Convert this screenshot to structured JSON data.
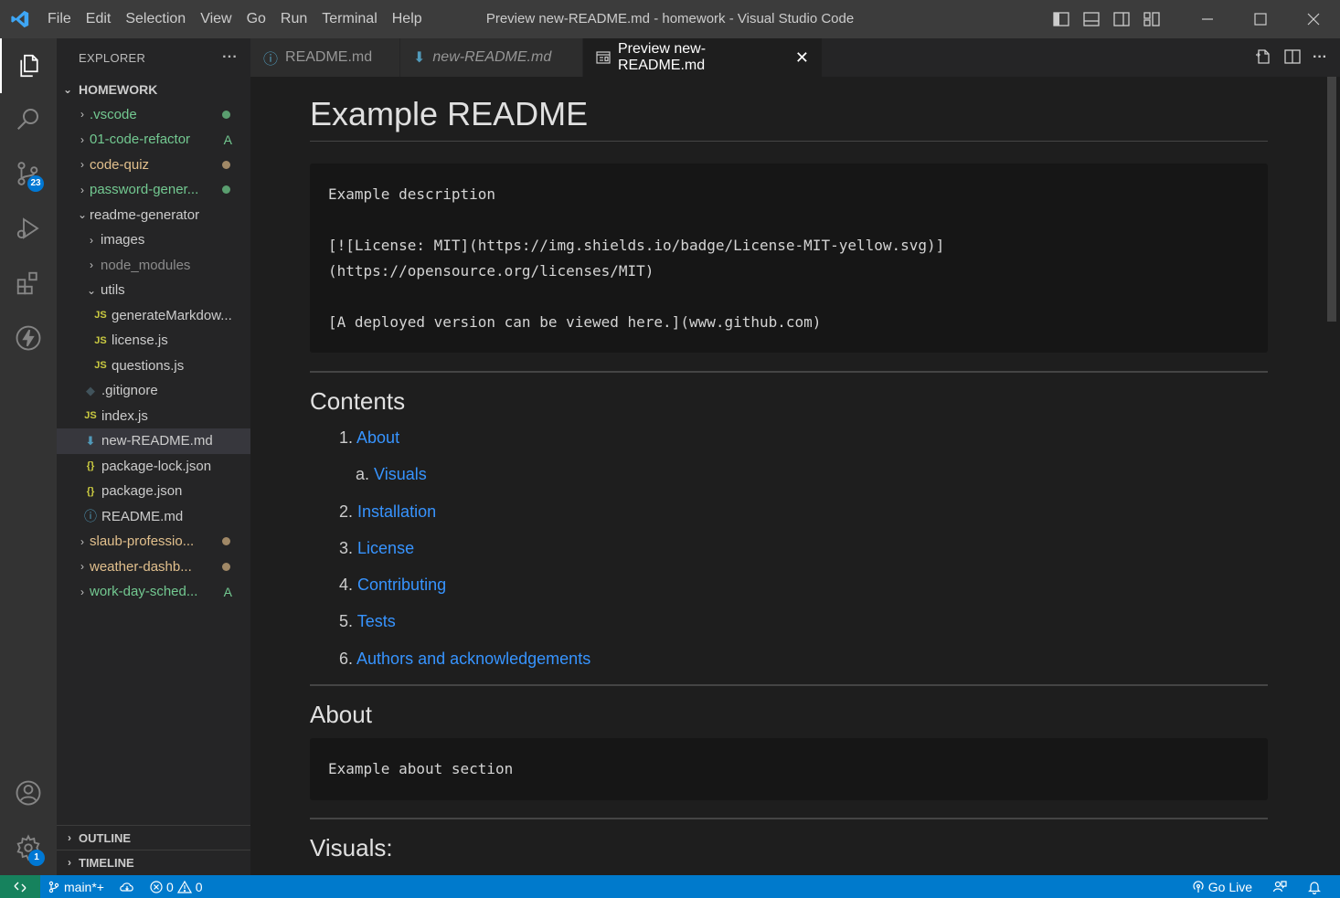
{
  "titlebar": {
    "menu": [
      "File",
      "Edit",
      "Selection",
      "View",
      "Go",
      "Run",
      "Terminal",
      "Help"
    ],
    "window_title": "Preview new-README.md - homework - Visual Studio Code"
  },
  "activity": {
    "source_control_badge": "23",
    "settings_badge": "1"
  },
  "sidebar": {
    "title": "EXPLORER",
    "more": "···",
    "root": "HOMEWORK",
    "items": [
      {
        "label": ".vscode",
        "color": "#73c991",
        "git": "dot"
      },
      {
        "label": "01-code-refactor",
        "color": "#73c991",
        "git": "A"
      },
      {
        "label": "code-quiz",
        "color": "#e2c08d",
        "git": "dot"
      },
      {
        "label": "password-gener...",
        "color": "#73c991",
        "git": "dot"
      },
      {
        "label": "readme-generator",
        "color": "#cccccc",
        "git": ""
      },
      {
        "label": "images",
        "color": "#cccccc",
        "git": ""
      },
      {
        "label": "node_modules",
        "color": "#8c8c8c",
        "git": ""
      },
      {
        "label": "utils",
        "color": "#cccccc",
        "git": ""
      },
      {
        "label": "generateMarkdow...",
        "color": "#cccccc",
        "git": ""
      },
      {
        "label": "license.js",
        "color": "#cccccc",
        "git": ""
      },
      {
        "label": "questions.js",
        "color": "#cccccc",
        "git": ""
      },
      {
        "label": ".gitignore",
        "color": "#cccccc",
        "git": ""
      },
      {
        "label": "index.js",
        "color": "#cccccc",
        "git": ""
      },
      {
        "label": "new-README.md",
        "color": "#cccccc",
        "git": ""
      },
      {
        "label": "package-lock.json",
        "color": "#cccccc",
        "git": ""
      },
      {
        "label": "package.json",
        "color": "#cccccc",
        "git": ""
      },
      {
        "label": "README.md",
        "color": "#cccccc",
        "git": ""
      },
      {
        "label": "slaub-professio...",
        "color": "#e2c08d",
        "git": "dot"
      },
      {
        "label": "weather-dashb...",
        "color": "#e2c08d",
        "git": "dot"
      },
      {
        "label": "work-day-sched...",
        "color": "#73c991",
        "git": "A"
      }
    ],
    "outline": "OUTLINE",
    "timeline": "TIMELINE"
  },
  "tabs": [
    {
      "label": "README.md"
    },
    {
      "label": "new-README.md"
    },
    {
      "label": "Preview new-README.md",
      "close": "✕"
    }
  ],
  "preview": {
    "title": "Example README",
    "code_lines": [
      "Example description",
      "",
      "[![License: MIT](https://img.shields.io/badge/License-MIT-yellow.svg)]",
      "(https://opensource.org/licenses/MIT)",
      "",
      "[A deployed version can be viewed here.](www.github.com)"
    ],
    "contents_heading": "Contents",
    "toc": [
      {
        "num": "1.",
        "label": "About"
      },
      {
        "num": "a.",
        "label": "Visuals"
      },
      {
        "num": "2.",
        "label": "Installation"
      },
      {
        "num": "3.",
        "label": "License"
      },
      {
        "num": "4.",
        "label": "Contributing"
      },
      {
        "num": "5.",
        "label": "Tests"
      },
      {
        "num": "6.",
        "label": "Authors and acknowledgements"
      }
    ],
    "about_heading": "About",
    "about_code": "Example about section",
    "visuals_heading": "Visuals:"
  },
  "status": {
    "branch": "main*+",
    "errors": "0",
    "warnings": "0",
    "go_live": "Go Live"
  }
}
